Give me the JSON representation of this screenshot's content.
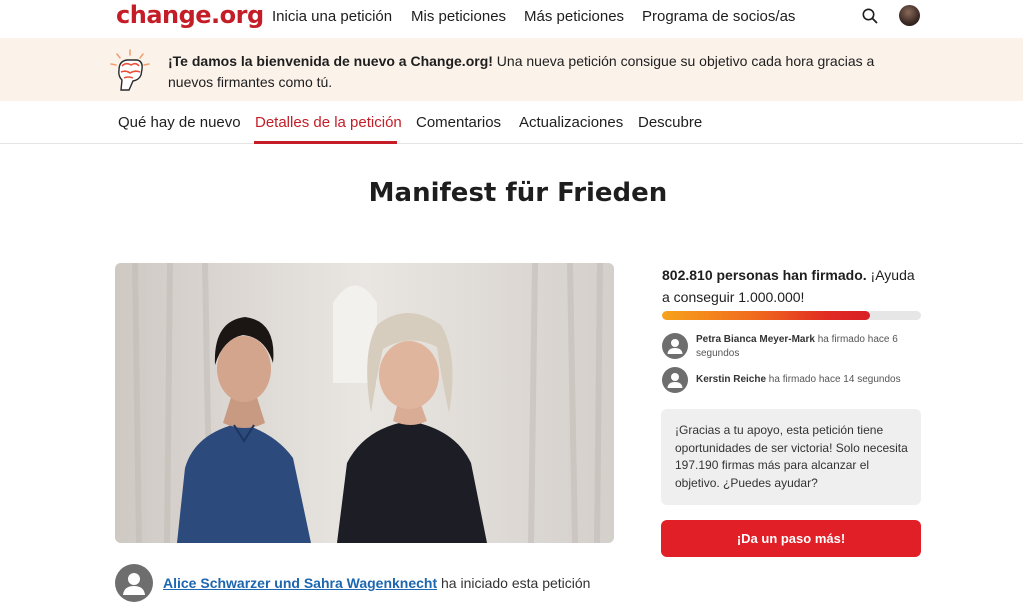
{
  "header": {
    "logo": "change.org",
    "nav": [
      "Inicia una petición",
      "Mis peticiones",
      "Más peticiones",
      "Programa de socios/as"
    ]
  },
  "banner": {
    "bold": "¡Te damos la bienvenida de nuevo a Change.org!",
    "rest": " Una nueva petición consigue su objetivo cada hora gracias a nuevos firmantes como tú."
  },
  "tabs": [
    "Qué hay de nuevo",
    "Detalles de la petición",
    "Comentarios",
    "Actualizaciones",
    "Descubre"
  ],
  "active_tab": "Detalles de la petición",
  "petition": {
    "title": "Manifest für Frieden",
    "starter_name": "Alice Schwarzer und Sahra Wagenknecht",
    "starter_suffix": " ha iniciado esta petición"
  },
  "signatures": {
    "count_text": "802.810 personas han firmado.",
    "goal_text": " ¡Ayuda a conseguir 1.000.000!",
    "progress": 0.8028,
    "recent": [
      {
        "name": "Petra Bianca Meyer-Mark",
        "text": " ha firmado hace 6 segundos"
      },
      {
        "name": "Kerstin Reiche",
        "text": " ha firmado hace 14 segundos"
      }
    ]
  },
  "support_box": "¡Gracias a tu apoyo, esta petición tiene oportunidades de ser victoria! Solo necesita 197.190 firmas más para alcanzar el objetivo. ¿Puedes ayudar?",
  "cta_label": "¡Da un paso más!",
  "colors": {
    "brand": "#c41d27",
    "link": "#1d66b0",
    "banner_bg": "#fbf2ea",
    "cta": "#e01f26"
  }
}
